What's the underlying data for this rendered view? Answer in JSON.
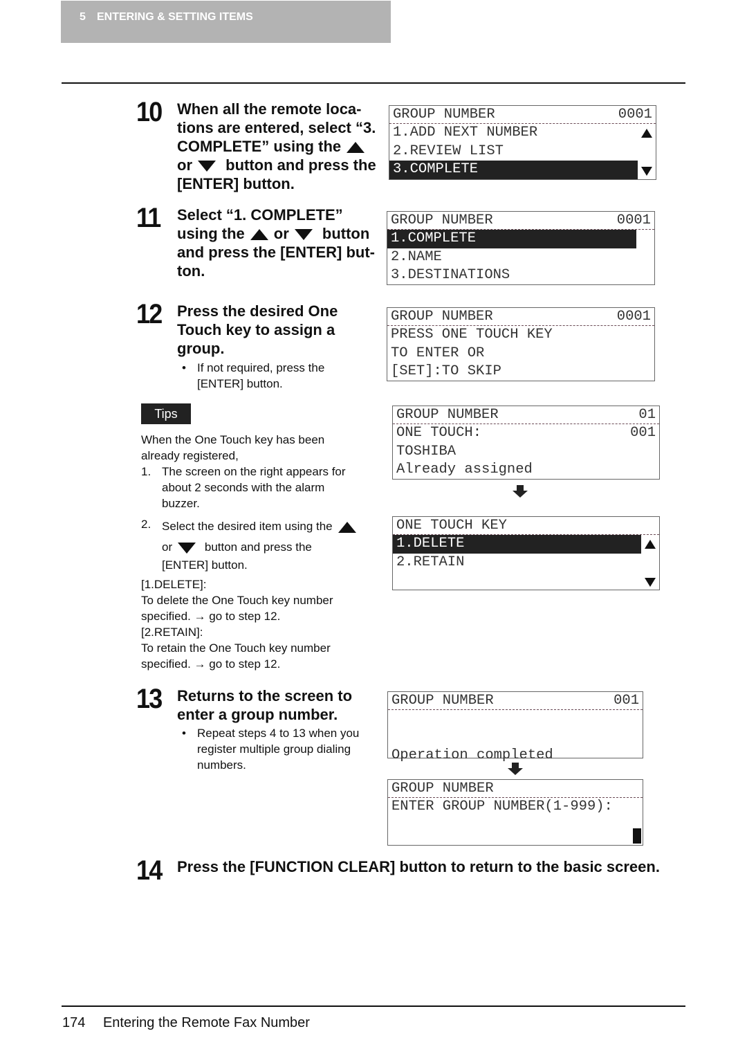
{
  "header": {
    "chapter": "5",
    "title": "ENTERING & SETTING ITEMS"
  },
  "steps": {
    "s10": {
      "num": "10",
      "lines": [
        "When all the remote loca-",
        "tions are entered, select “3.",
        "COMPLETE” using the",
        "or",
        "button and press the",
        "[ENTER] button."
      ]
    },
    "s11": {
      "num": "11",
      "lines": [
        "Select “1. COMPLETE”",
        "using the",
        "or",
        "button",
        "and press the [ENTER] but-",
        "ton."
      ]
    },
    "s12": {
      "num": "12",
      "lines": [
        "Press the desired One",
        "Touch key to assign a",
        "group."
      ],
      "bullet": [
        "If not required, press the",
        "[ENTER] button."
      ]
    },
    "s13": {
      "num": "13",
      "lines": [
        "Returns to the screen to",
        "enter a group number."
      ],
      "bullet": [
        "Repeat steps 4 to 13 when you",
        "register multiple group dialing",
        "numbers."
      ]
    },
    "s14": {
      "num": "14",
      "text": "Press the [FUNCTION CLEAR] button to return to the basic screen."
    }
  },
  "tips": {
    "label": "Tips",
    "intro": [
      "When the One Touch key has been",
      "already registered,"
    ],
    "item1": {
      "n": "1.",
      "lines": [
        "The screen on the right appears for",
        "about 2 seconds with the alarm",
        "buzzer."
      ]
    },
    "item2": {
      "n": "2.",
      "l1": "Select the desired item using the",
      "l2a": "or",
      "l2b": "button and press the",
      "l3": "[ENTER] button."
    },
    "rest": [
      "[1.DELETE]:",
      "To delete the One Touch key number",
      "specified. → go to step 12.",
      "[2.RETAIN]:",
      "To retain the One Touch key number",
      "specified. → go to step 12."
    ]
  },
  "lcds": [
    {
      "rows": [
        {
          "text": "GROUP NUMBER",
          "right": "0001",
          "hd": true
        },
        {
          "text": "1.ADD NEXT NUMBER",
          "arrow": "up"
        },
        {
          "text": "2.REVIEW LIST"
        },
        {
          "text": "3.COMPLETE",
          "hl": true,
          "arrow": "dn"
        }
      ]
    },
    {
      "rows": [
        {
          "text": "GROUP NUMBER",
          "right": "0001",
          "hd": true
        },
        {
          "text": "1.COMPLETE",
          "hl": true
        },
        {
          "text": "2.NAME"
        },
        {
          "text": "3.DESTINATIONS"
        }
      ]
    },
    {
      "rows": [
        {
          "text": "GROUP NUMBER",
          "right": "0001",
          "hd": true
        },
        {
          "text": "PRESS ONE TOUCH KEY"
        },
        {
          "text": "TO ENTER OR"
        },
        {
          "text": "[SET]:TO SKIP"
        }
      ]
    },
    {
      "rows": [
        {
          "text": "GROUP NUMBER",
          "right": "01",
          "hd": true
        },
        {
          "text": "ONE TOUCH:",
          "right": "001"
        },
        {
          "text": "TOSHIBA"
        },
        {
          "text": "Already assigned"
        }
      ]
    },
    {
      "rows": [
        {
          "text": "ONE TOUCH KEY",
          "hd": true
        },
        {
          "text": "1.DELETE",
          "hl": true,
          "arrow": "up"
        },
        {
          "text": "2.RETAIN"
        },
        {
          "text": "",
          "arrow": "dn"
        }
      ]
    },
    {
      "rows": [
        {
          "text": "GROUP NUMBER",
          "right": "001",
          "hd": true
        },
        {
          "text": ""
        },
        {
          "text": ""
        },
        {
          "text": "Operation completed"
        }
      ]
    },
    {
      "rows": [
        {
          "text": "GROUP NUMBER",
          "hd": true
        },
        {
          "text": "ENTER GROUP NUMBER(1-999):"
        },
        {
          "text": ""
        },
        {
          "text": ""
        }
      ],
      "cursor": true
    }
  ],
  "footer": {
    "page": "174",
    "title": "Entering the Remote Fax Number"
  }
}
